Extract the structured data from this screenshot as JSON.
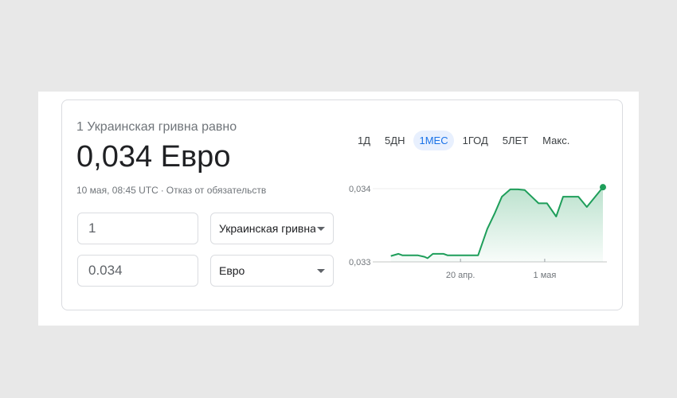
{
  "header": {
    "subtitle": "1 Украинская гривна равно",
    "result": "0,034 Евро",
    "timestamp": "10 мая, 08:45 UTC",
    "timestamp_separator": "·",
    "disclaimer": "Отказ от обязательств"
  },
  "converter": {
    "from_amount": "1",
    "from_currency": "Украинская гривна",
    "to_amount": "0.034",
    "to_currency": "Евро"
  },
  "tabs": [
    {
      "label": "1Д",
      "active": false
    },
    {
      "label": "5ДН",
      "active": false
    },
    {
      "label": "1МЕС",
      "active": true
    },
    {
      "label": "1ГОД",
      "active": false
    },
    {
      "label": "5ЛЕТ",
      "active": false
    },
    {
      "label": "Макс.",
      "active": false
    }
  ],
  "colors": {
    "line": "#1e9e5a",
    "active_tab": "#1a73e8"
  },
  "chart_data": {
    "type": "area",
    "y_ticks": [
      0.033,
      0.034
    ],
    "y_tick_labels": [
      "0,033",
      "0,034"
    ],
    "x_ticks": [
      {
        "label": "20 апр.",
        "day": 20
      },
      {
        "label": "1 мая",
        "day": 31
      }
    ],
    "ylim": [
      0.033,
      0.0341
    ],
    "x": [
      10.9,
      11.9,
      12.4,
      13.4,
      14.4,
      15.3,
      15.7,
      16.4,
      17.4,
      17.8,
      18.3,
      19.3,
      20.3,
      21.3,
      22.3,
      23.5,
      24.5,
      25.4,
      26.5,
      27.5,
      28.4,
      29.2,
      30.2,
      31.3,
      32.5,
      33.4,
      34.4,
      35.4,
      36.5,
      38.6
    ],
    "values": [
      0.03308,
      0.03311,
      0.03309,
      0.03309,
      0.03309,
      0.03307,
      0.03305,
      0.03311,
      0.03311,
      0.03311,
      0.03309,
      0.03309,
      0.03309,
      0.03309,
      0.03309,
      0.03345,
      0.03367,
      0.03389,
      0.03399,
      0.03399,
      0.03398,
      0.0339,
      0.0338,
      0.0338,
      0.03362,
      0.03389,
      0.03389,
      0.03389,
      0.03375,
      0.03402
    ]
  }
}
